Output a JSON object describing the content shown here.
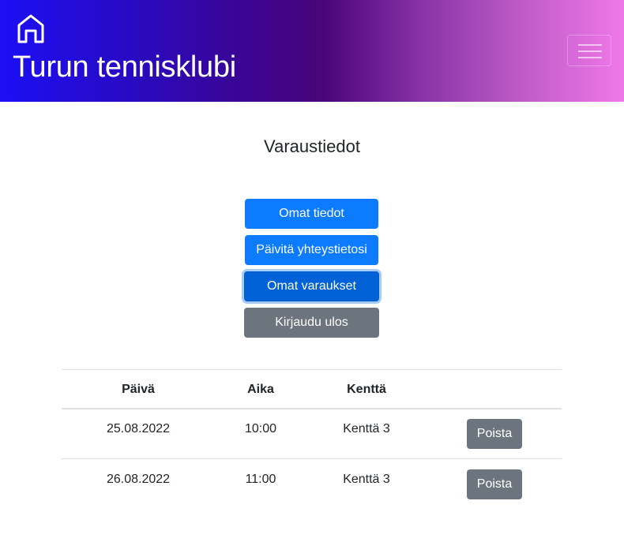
{
  "header": {
    "brand": "Turun tennisklubi",
    "home_icon": "home-icon",
    "menu_icon": "hamburger-menu-icon",
    "gradient_colors": [
      "#1b0ff5",
      "#4a0578",
      "#ef78e8"
    ]
  },
  "page": {
    "title": "Varaustiedot"
  },
  "actions": {
    "own_info": "Omat tiedot",
    "update_contact": "Päivitä yhteystietosi",
    "own_reservations": "Omat varaukset",
    "logout": "Kirjaudu ulos"
  },
  "colors": {
    "primary": "#0d7bff",
    "primary_active": "#0062d6",
    "secondary": "#6c757d"
  },
  "table": {
    "headers": [
      "Päivä",
      "Aika",
      "Kenttä",
      ""
    ],
    "rows": [
      {
        "date": "25.08.2022",
        "time": "10:00",
        "court": "Kenttä 3",
        "action": "Poista"
      },
      {
        "date": "26.08.2022",
        "time": "11:00",
        "court": "Kenttä 3",
        "action": "Poista"
      }
    ]
  }
}
